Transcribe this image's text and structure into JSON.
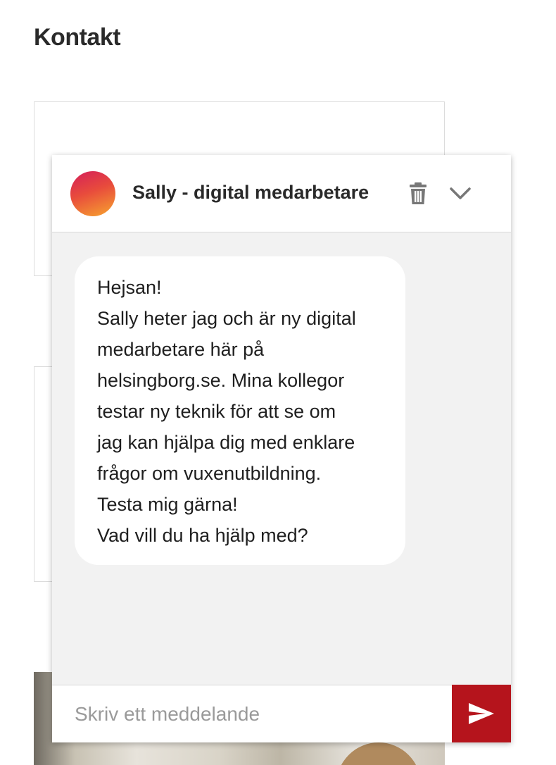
{
  "page": {
    "heading": "Kontakt"
  },
  "chat": {
    "bot_name": "Sally - digital medarbetare",
    "avatar_gradient": [
      "#d41f5a",
      "#e84b3c",
      "#f7a52f"
    ],
    "header_icons": [
      "trash-icon",
      "chevron-down-icon"
    ],
    "messages": [
      {
        "sender": "bot",
        "lines": [
          "Hejsan!",
          "Sally heter jag och är ny digital",
          "medarbetare här på",
          "helsingborg.se. Mina kollegor",
          "testar ny teknik för att se om",
          "jag kan hjälpa dig med enklare",
          "frågor om vuxenutbildning.",
          "Testa mig gärna!",
          "Vad vill du ha hjälp med?"
        ]
      }
    ],
    "input": {
      "placeholder": "Skriv ett meddelande",
      "value": ""
    },
    "send_icon": "send-icon",
    "colors": {
      "send_button": "#b5141c",
      "chat_background": "#f2f2f2",
      "icon_gray": "#777777"
    }
  }
}
